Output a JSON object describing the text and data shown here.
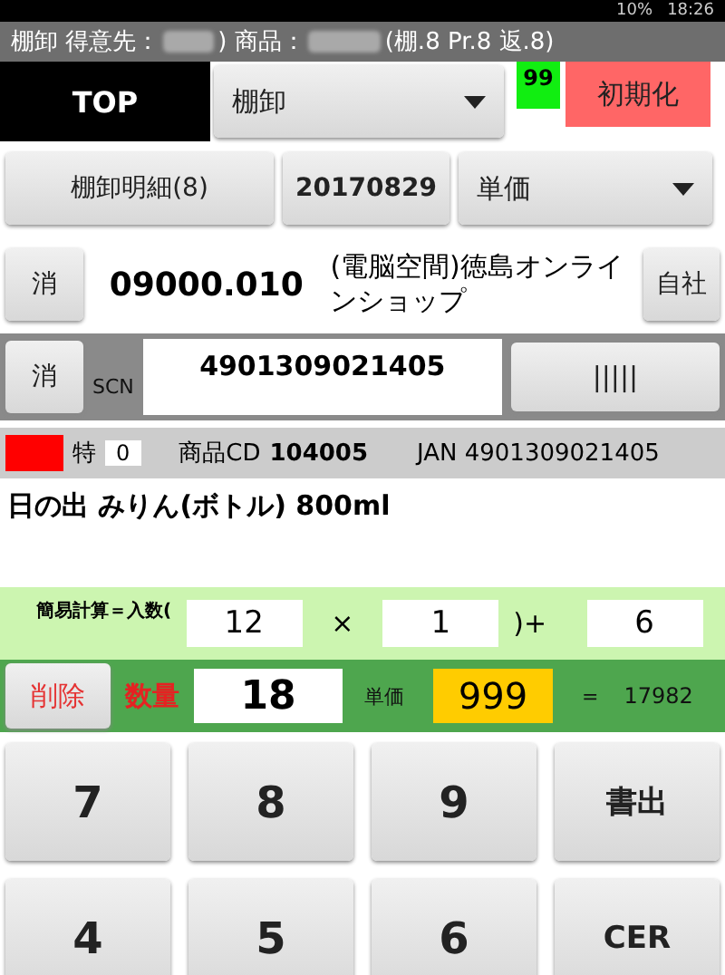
{
  "status_bar": {
    "battery": "10%",
    "time": "18:26"
  },
  "title_bar": {
    "parts": [
      "棚卸 得意先：",
      ") 商品：",
      "(棚.8 Pr.8 返.8)"
    ]
  },
  "top_row": {
    "top_button": "TOP",
    "mode_dropdown": "棚卸",
    "counter": "99",
    "reset_button": "初期化"
  },
  "detail_row": {
    "detail_button": "棚卸明細(8)",
    "date_button": "20170829",
    "price_dropdown": "単価"
  },
  "customer_row": {
    "clear_button": "消",
    "code": "09000.010",
    "name": "(電脳空間)徳島オンラインショップ",
    "own_button": "自社"
  },
  "scan_row": {
    "clear_button": "消",
    "label": "SCN",
    "value": "4901309021405",
    "barcode_button": "|||||"
  },
  "info_row": {
    "special_label": "特",
    "special_value": "0",
    "product_cd_label": "商品CD",
    "product_cd": "104005",
    "jan": "JAN 4901309021405"
  },
  "product_name": "日の出 みりん(ボトル) 800ml",
  "calc_row": {
    "label": "簡易計算＝入数(",
    "case_qty": "12",
    "times": "×",
    "cases": "1",
    "plus": ")+",
    "loose": "6"
  },
  "qty_row": {
    "delete_button": "削除",
    "qty_label": "数量",
    "qty": "18",
    "price_label": "単価",
    "price": "999",
    "equals": "=",
    "total": "17982"
  },
  "keypad": [
    {
      "label": "7"
    },
    {
      "label": "8"
    },
    {
      "label": "9"
    },
    {
      "label": "書出"
    },
    {
      "label": "4"
    },
    {
      "label": "5"
    },
    {
      "label": "6"
    },
    {
      "label": "CER"
    }
  ]
}
